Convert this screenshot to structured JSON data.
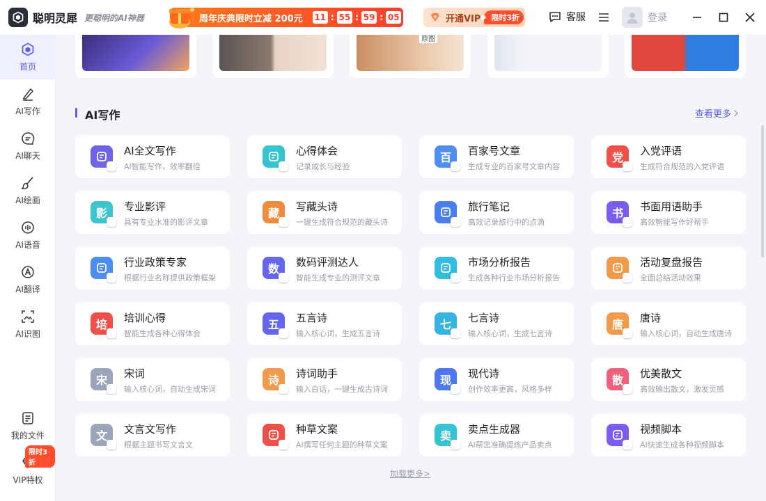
{
  "header": {
    "app_name": "聪明灵犀",
    "slogan": "更聪明的AI神器",
    "promo_text": "周年庆典限时立减 200元",
    "timer": [
      "11",
      "55",
      "59",
      "05"
    ],
    "vip_label": "开通VIP",
    "vip_tag": "限时3折",
    "service_label": "客服",
    "login_label": "登录"
  },
  "sidebar": {
    "items": [
      {
        "label": "首页",
        "icon": "home-icon"
      },
      {
        "label": "AI写作",
        "icon": "pen-icon"
      },
      {
        "label": "AI聊天",
        "icon": "chat-icon"
      },
      {
        "label": "AI绘画",
        "icon": "brush-icon"
      },
      {
        "label": "AI语音",
        "icon": "voice-icon"
      },
      {
        "label": "AI翻译",
        "icon": "translate-icon"
      },
      {
        "label": "AI识图",
        "icon": "image-recognition-icon"
      }
    ],
    "bottom": [
      {
        "label": "我的文件",
        "icon": "file-icon"
      },
      {
        "label": "VIP特权",
        "icon": "vip-diamond-icon"
      }
    ],
    "vip_badge": "限时3折"
  },
  "banners": {
    "label_original": "原图",
    "colors": [
      "#6a5bd8",
      "#8b7a6e",
      "#e9c7a8",
      "#dfe6ee",
      "#e0483e"
    ]
  },
  "section": {
    "title": "AI写作",
    "see_more": "查看更多"
  },
  "cards": [
    {
      "title": "AI全文写作",
      "desc": "AI智能写作，效率翻倍",
      "icon": "feather-icon",
      "glyph": "",
      "color": "#6e63ea"
    },
    {
      "title": "心得体会",
      "desc": "记录成长与经验",
      "icon": "notebook-icon",
      "glyph": "",
      "color": "#36c4d2"
    },
    {
      "title": "百家号文章",
      "desc": "生成专业的百家号文章内容",
      "icon": "baijiahao-icon",
      "glyph": "百",
      "color": "#4e8ef0"
    },
    {
      "title": "入党评语",
      "desc": "生成符合规范的入党评语",
      "icon": "party-icon",
      "glyph": "党",
      "color": "#f0504a"
    },
    {
      "title": "专业影评",
      "desc": "具有专业水准的影评文章",
      "icon": "film-review-icon",
      "glyph": "影",
      "color": "#3cc4cf"
    },
    {
      "title": "写藏头诗",
      "desc": "一键生成符合规范的藏头诗",
      "icon": "acrostic-poem-icon",
      "glyph": "藏",
      "color": "#f08a3c"
    },
    {
      "title": "旅行笔记",
      "desc": "高效记录旅行中的点滴",
      "icon": "travel-note-icon",
      "glyph": "",
      "color": "#4a7ef0"
    },
    {
      "title": "书面用语助手",
      "desc": "高效智能写作好帮手",
      "icon": "book-icon",
      "glyph": "书",
      "color": "#7b5cf0"
    },
    {
      "title": "行业政策专家",
      "desc": "根据行业名称提供政策框架",
      "icon": "policy-icon",
      "glyph": "",
      "color": "#4e8ef0"
    },
    {
      "title": "数码评测达人",
      "desc": "智能生成专业的测评文章",
      "icon": "digital-review-icon",
      "glyph": "数",
      "color": "#6466f0"
    },
    {
      "title": "市场分析报告",
      "desc": "生成各种行业市场分析报告",
      "icon": "pie-chart-icon",
      "glyph": "",
      "color": "#30bde0"
    },
    {
      "title": "活动复盘报告",
      "desc": "全面总结活动效果",
      "icon": "hourglass-icon",
      "glyph": "",
      "color": "#f39a4a"
    },
    {
      "title": "培训心得",
      "desc": "智能生成各种心得体会",
      "icon": "training-icon",
      "glyph": "培",
      "color": "#f0504a"
    },
    {
      "title": "五言诗",
      "desc": "输入核心词，生成五言诗",
      "icon": "five-char-poem-icon",
      "glyph": "五",
      "color": "#6466f0"
    },
    {
      "title": "七言诗",
      "desc": "输入核心词，生成七言诗",
      "icon": "seven-char-poem-icon",
      "glyph": "七",
      "color": "#36b4e0"
    },
    {
      "title": "唐诗",
      "desc": "输入核心词，自动生成唐诗",
      "icon": "tang-poem-icon",
      "glyph": "唐",
      "color": "#f39a4a"
    },
    {
      "title": "宋词",
      "desc": "输入核心词，自动生成宋词",
      "icon": "song-ci-icon",
      "glyph": "宋",
      "color": "#9aa4bb"
    },
    {
      "title": "诗词助手",
      "desc": "输入白话，一键生成古诗词",
      "icon": "poetry-helper-icon",
      "glyph": "诗",
      "color": "#f39a4a"
    },
    {
      "title": "现代诗",
      "desc": "创作效率更高，风格多样",
      "icon": "modern-poem-icon",
      "glyph": "现",
      "color": "#4e78f0"
    },
    {
      "title": "优美散文",
      "desc": "高效输出散文，激发灵感",
      "icon": "prose-icon",
      "glyph": "散",
      "color": "#f0607a"
    },
    {
      "title": "文言文写作",
      "desc": "根据主题书写文言文",
      "icon": "classical-chinese-icon",
      "glyph": "文",
      "color": "#9aa4bb"
    },
    {
      "title": "种草文案",
      "desc": "AI撰写任何主题的种草文案",
      "icon": "sprout-icon",
      "glyph": "",
      "color": "#f0504a"
    },
    {
      "title": "卖点生成器",
      "desc": "AI帮您准确提炼产品卖点",
      "icon": "selling-point-icon",
      "glyph": "卖",
      "color": "#36c4d2"
    },
    {
      "title": "视频脚本",
      "desc": "AI快速生成各种视频脚本",
      "icon": "video-script-icon",
      "glyph": "",
      "color": "#7b5cf0"
    }
  ],
  "load_more": "加载更多>"
}
